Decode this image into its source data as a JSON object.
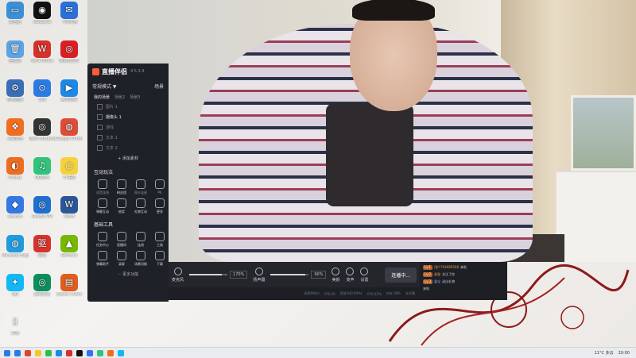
{
  "desktop": {
    "icons": [
      {
        "label": "此电脑",
        "color": "#3a8fd6",
        "glyph": "▭"
      },
      {
        "label": "WeGame",
        "color": "#111111",
        "glyph": "◉"
      },
      {
        "label": "飞书文档",
        "color": "#2b6fd8",
        "glyph": "✉"
      },
      {
        "label": "QQ音乐",
        "color": "#f7c21c",
        "glyph": "♪"
      },
      {
        "label": "回收站",
        "color": "#5ca3e6",
        "glyph": "🗑"
      },
      {
        "label": "WPS Office",
        "color": "#d6312b",
        "glyph": "W"
      },
      {
        "label": "网易云音乐",
        "color": "#d91f24",
        "glyph": "◎"
      },
      {
        "label": "迅雷",
        "color": "#e76a2a",
        "glyph": "✦"
      },
      {
        "label": "控制面板",
        "color": "#3a6fb5",
        "glyph": "⚙"
      },
      {
        "label": "360",
        "color": "#2c7be5",
        "glyph": "⊙"
      },
      {
        "label": "腾讯视频",
        "color": "#1e88e5",
        "glyph": "▶"
      },
      {
        "label": "百度网盘",
        "color": "#2f7ae5",
        "glyph": "☁"
      },
      {
        "label": "火绒安全",
        "color": "#f26e1f",
        "glyph": "❖"
      },
      {
        "label": "Open Broadcaster",
        "color": "#333333",
        "glyph": "◎"
      },
      {
        "label": "Google Chrome",
        "color": "#dd4b39",
        "glyph": "◍"
      },
      {
        "label": "WeChat",
        "color": "#2dbf4b",
        "glyph": "✿"
      },
      {
        "label": "Firefox",
        "color": "#ef6b1f",
        "glyph": "◐"
      },
      {
        "label": "QQ音乐",
        "color": "#31c27c",
        "glyph": "♫"
      },
      {
        "label": "YY语音",
        "color": "#f4d23b",
        "glyph": "○"
      },
      {
        "label": "Steam",
        "color": "#1b2838",
        "glyph": "◈"
      },
      {
        "label": "Lenovo",
        "color": "#3578e5",
        "glyph": "◆"
      },
      {
        "label": "Oracle VM",
        "color": "#1f6fd1",
        "glyph": "◎"
      },
      {
        "label": "Word",
        "color": "#2b579a",
        "glyph": "W"
      },
      {
        "label": "飞书",
        "color": "#3370ff",
        "glyph": "✈"
      },
      {
        "label": "Microsoft Edge",
        "color": "#1f9bde",
        "glyph": "◍"
      },
      {
        "label": "驱动",
        "color": "#d9322e",
        "glyph": "驱"
      },
      {
        "label": "GeForce",
        "color": "#76b900",
        "glyph": "▲"
      },
      {
        "label": "Google Play",
        "color": "#34a853",
        "glyph": "▶"
      },
      {
        "label": "QQ",
        "color": "#12b7f5",
        "glyph": "✦"
      },
      {
        "label": "腾讯会议",
        "color": "#0a8f5c",
        "glyph": "◎"
      },
      {
        "label": "Steam Client",
        "color": "#e05d1d",
        "glyph": "▤"
      },
      {
        "label": "Nintendo",
        "color": "#2f5fb3",
        "glyph": "◉"
      },
      {
        "label": "文档",
        "color": "#f2f2f2",
        "glyph": "▯"
      }
    ]
  },
  "app": {
    "title": "直播伴侣",
    "version": "4.5.3.4",
    "mode_label": "常规模式 ▼",
    "mode_right": "场景",
    "scene_tabs": [
      "我的场景",
      "场景2",
      "场景3"
    ],
    "sources": [
      {
        "label": "图片 1",
        "active": false
      },
      {
        "label": "摄像头 1",
        "active": true
      },
      {
        "label": "游戏",
        "active": false
      },
      {
        "label": "文本 1",
        "active": false
      },
      {
        "label": "文本 2",
        "active": false
      }
    ],
    "add_source": "+ 添加素材",
    "interactive_title": "互动玩法",
    "interactive_tools": [
      {
        "label": "语音连线",
        "on": false
      },
      {
        "label": "粉丝团",
        "on": true
      },
      {
        "label": "观众连麦",
        "on": false
      },
      {
        "label": "PK",
        "on": false
      },
      {
        "label": "弹幕互动",
        "on": true
      },
      {
        "label": "抽奖",
        "on": true
      },
      {
        "label": "礼物互动",
        "on": true
      },
      {
        "label": "更多",
        "on": true
      }
    ],
    "basic_title": "基础工具",
    "basic_tools": [
      {
        "label": "任务中心",
        "on": true
      },
      {
        "label": "直播间",
        "on": true
      },
      {
        "label": "连线",
        "on": true
      },
      {
        "label": "工具",
        "on": true
      },
      {
        "label": "弹幕助手",
        "on": true
      },
      {
        "label": "录屏",
        "on": true
      },
      {
        "label": "场景切换",
        "on": true
      },
      {
        "label": "下载",
        "on": true
      }
    ],
    "more_label": "··· 更多功能"
  },
  "controls": {
    "mic_label": "麦克风",
    "mic_value": "170%",
    "mic_level": 0.85,
    "speaker_label": "扬声器",
    "speaker_value": "90%",
    "speaker_level": 0.9,
    "beauty_label": "美颜",
    "voice_label": "变声",
    "settings_label": "设置",
    "live_button": "连播中..."
  },
  "status": {
    "items": [
      "码率0Kb/s",
      "FPS:30",
      "丢帧:0(0.00%)",
      "CPU:22%",
      "内存:38%",
      "未开播"
    ]
  },
  "chat": {
    "lines": [
      {
        "badge": "Lv.1",
        "name": "用户764689598",
        "text": "来啦",
        "blue": false
      },
      {
        "badge": "Lv.2",
        "name": "星星",
        "text": "关注了你",
        "blue": false
      },
      {
        "badge": "Lv.3",
        "name": "露宝",
        "text": "送出礼物",
        "blue": true
      }
    ],
    "footer": "来啦"
  },
  "taskbar": {
    "weather": "11°C 多云",
    "time": "20:00",
    "apps": [
      "#2b7be5",
      "#e0442b",
      "#f4c72a",
      "#2dbf4b",
      "#1e88e5",
      "#d6312b",
      "#111111",
      "#3370ff",
      "#31c27c",
      "#ef6b1f",
      "#12b7f5"
    ]
  }
}
